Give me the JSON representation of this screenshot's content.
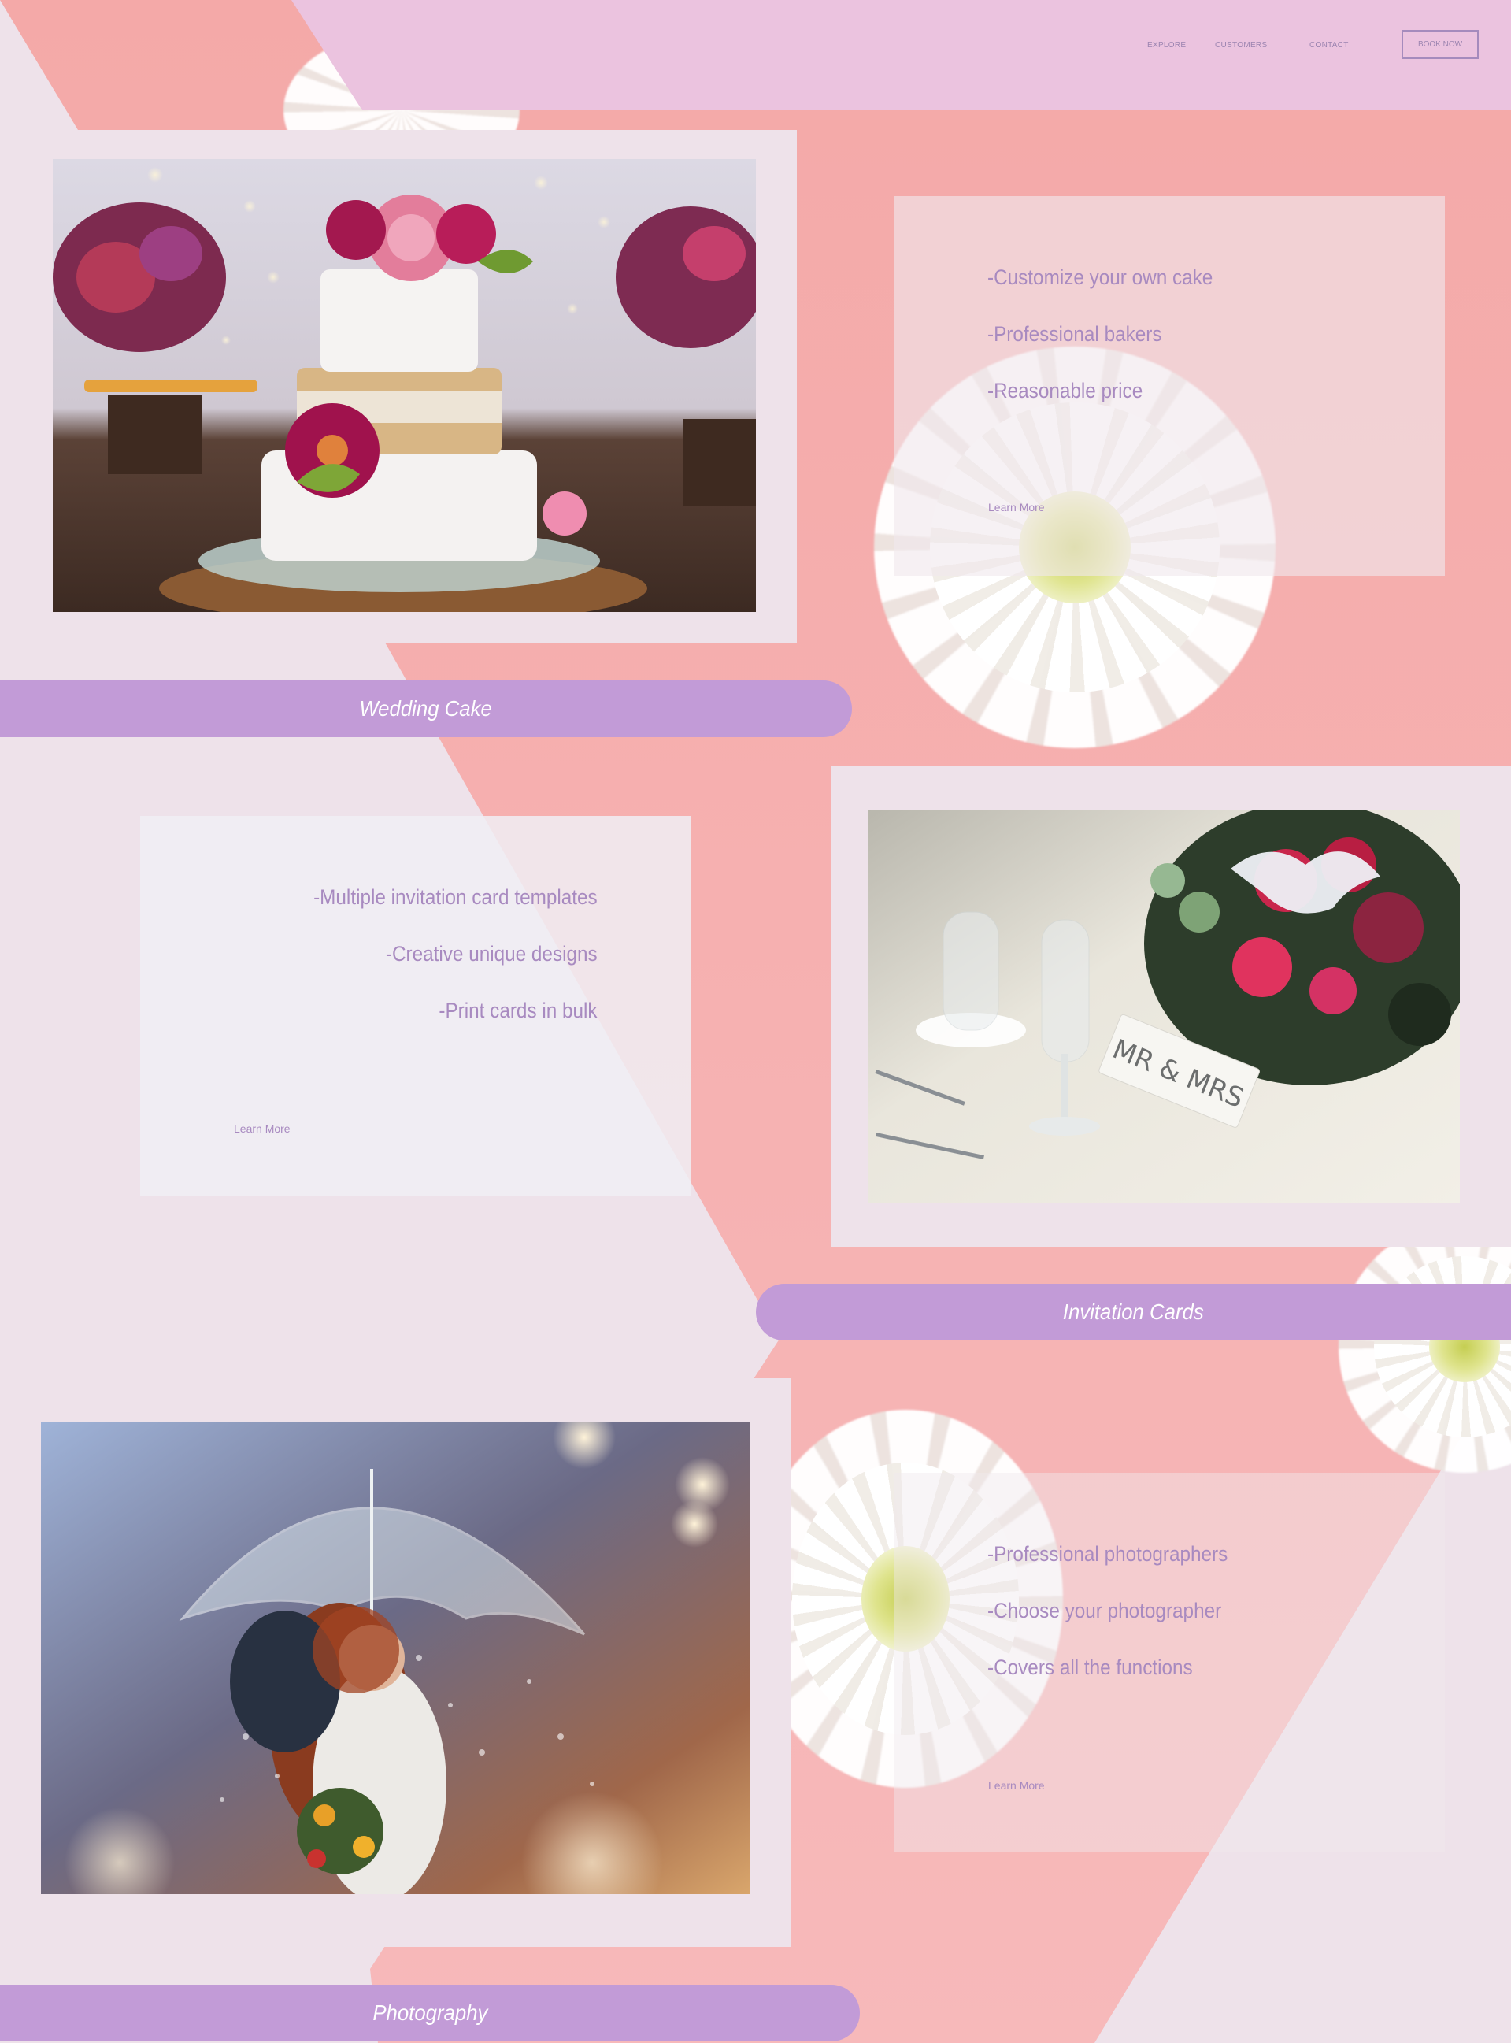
{
  "nav": {
    "links": [
      "EXPLORE",
      "CUSTOMERS",
      "CONTACT"
    ],
    "book_button": "BOOK NOW"
  },
  "sections": [
    {
      "title": "Wedding Cake",
      "features": [
        "-Customize your own cake",
        "-Professional bakers",
        "-Reasonable price"
      ],
      "learn_more": "Learn More",
      "image_alt": "three-tier white wedding cake with pink and magenta peonies"
    },
    {
      "title": "Invitation Cards",
      "features": [
        "-Multiple invitation card templates",
        "-Creative unique designs",
        "-Print cards in bulk"
      ],
      "learn_more": "Learn More",
      "image_alt": "wedding table with glasses, flowers and MR & MRS sign",
      "sign_text": "MR & MRS"
    },
    {
      "title": "Photography",
      "features": [
        "-Professional photographers",
        "-Choose your photographer",
        "-Covers all the functions"
      ],
      "learn_more": "Learn More",
      "image_alt": "couple under a clear umbrella in the rain"
    }
  ],
  "colors": {
    "header": "#ebc3df",
    "pink_background": "#f4a9a8",
    "lilac_background": "#eee2ea",
    "pill": "#c29bd7",
    "text_accent": "#a88ac0"
  }
}
